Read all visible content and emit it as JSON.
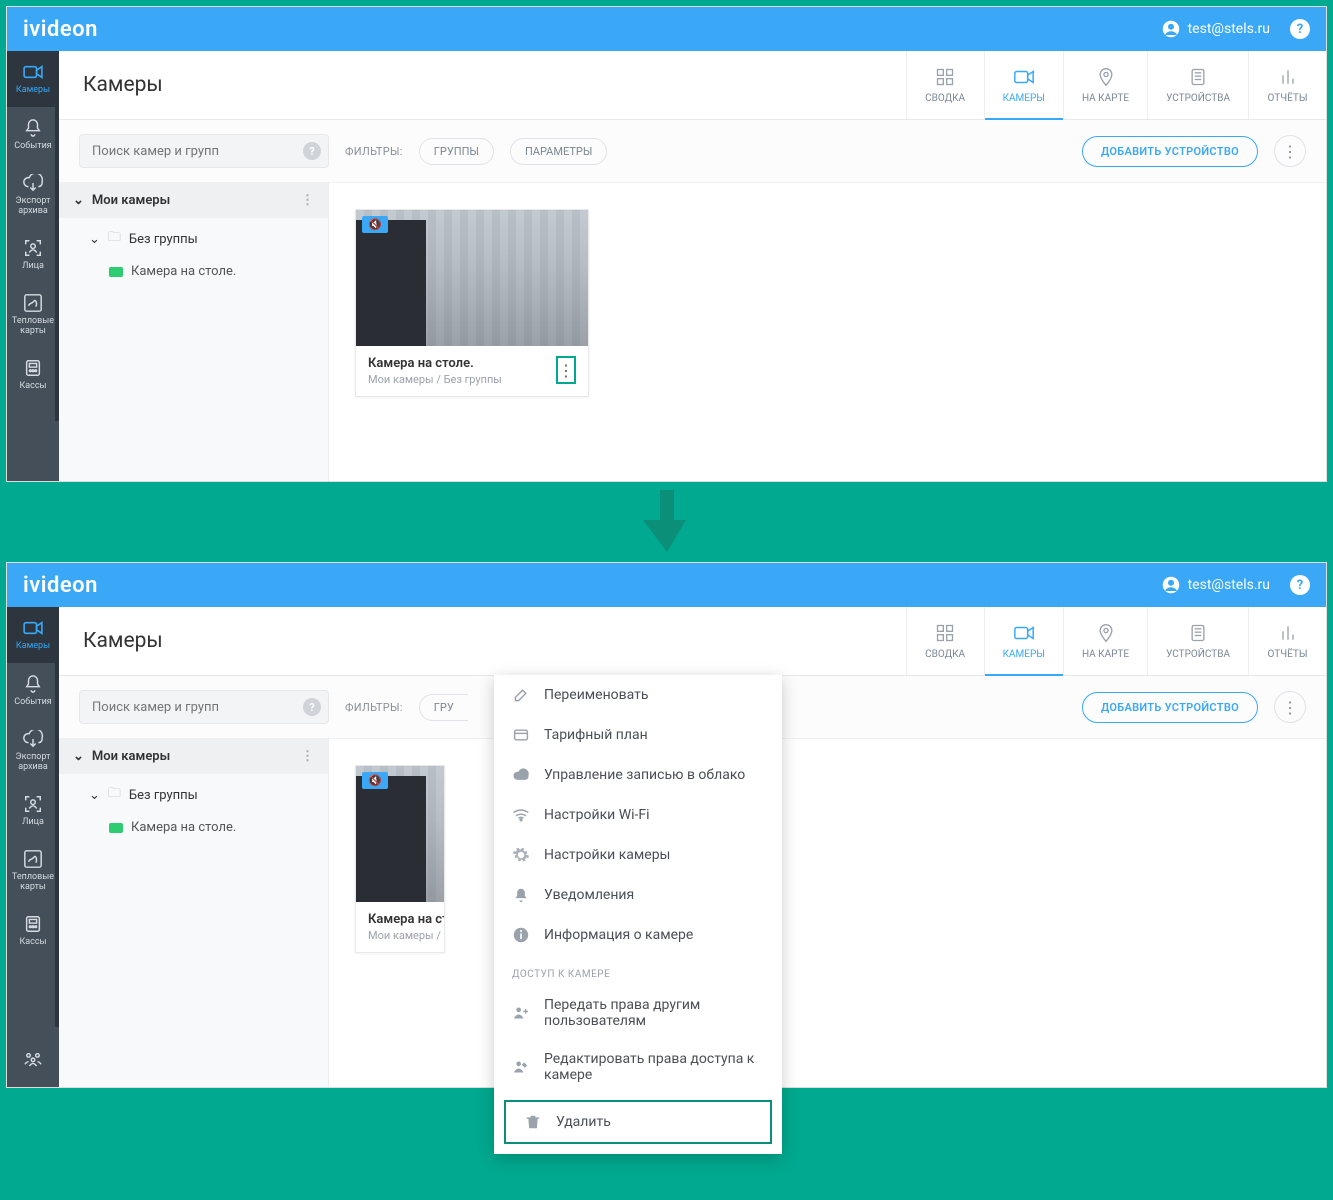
{
  "brand": "ivideon",
  "user_email": "test@stels.ru",
  "page_title": "Камеры",
  "sidebar_items": [
    {
      "label": "Камеры"
    },
    {
      "label": "События"
    },
    {
      "label": "Экспорт архива"
    },
    {
      "label": "Лица"
    },
    {
      "label": "Тепловые карты"
    },
    {
      "label": "Кассы"
    }
  ],
  "top_tabs": [
    {
      "label": "СВОДКА"
    },
    {
      "label": "КАМЕРЫ"
    },
    {
      "label": "НА КАРТЕ"
    },
    {
      "label": "УСТРОЙСТВА"
    },
    {
      "label": "ОТЧЁТЫ"
    }
  ],
  "search_placeholder": "Поиск камер и групп",
  "filters_label": "ФИЛЬТРЫ:",
  "filter_groups": "ГРУППЫ",
  "filter_params": "ПАРАМЕТРЫ",
  "add_device_label": "ДОБАВИТЬ УСТРОЙСТВО",
  "tree_root": "Мои камеры",
  "tree_group": "Без группы",
  "tree_camera": "Камера на столе.",
  "camera_card": {
    "name": "Камера на столе.",
    "path": "Мои камеры / Без группы"
  },
  "camera_card_cut": {
    "name": "Камера на ст",
    "path": "Мои камеры / "
  },
  "ctx": {
    "rename": "Переименовать",
    "tariff": "Тарифный план",
    "cloud_rec": "Управление записью в облако",
    "wifi": "Настройки Wi-Fi",
    "cam_settings": "Настройки камеры",
    "notifications": "Уведомления",
    "info": "Информация о камере",
    "section": "ДОСТУП К КАМЕРЕ",
    "share": "Передать права другим пользователям",
    "edit_access": "Редактировать права доступа к камере",
    "delete": "Удалить"
  },
  "filter_groups_cut": "ГРУ"
}
